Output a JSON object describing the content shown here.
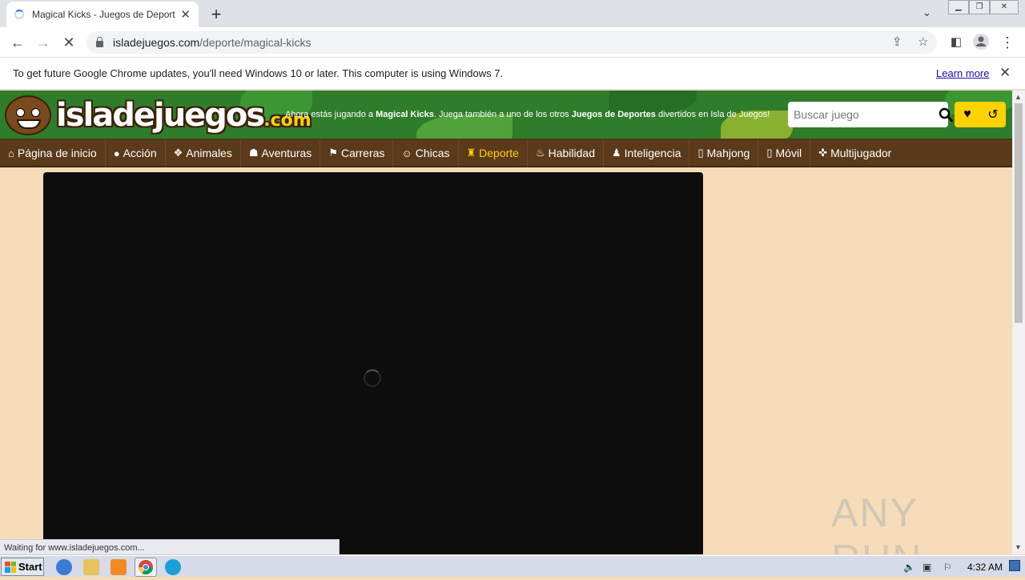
{
  "browser": {
    "tab_title": "Magical Kicks - Juegos de Deportes",
    "url_domain": "isladejuegos.com",
    "url_path": "/deporte/magical-kicks",
    "info_text": "To get future Google Chrome updates, you'll need Windows 10 or later. This computer is using Windows 7.",
    "info_link": "Learn more",
    "status_text": "Waiting for www.isladejuegos.com..."
  },
  "site": {
    "logo_main": "isladejuegos",
    "logo_suffix": ".com",
    "tagline_pre": "Ahora estás jugando a ",
    "tagline_game": "Magical Kicks",
    "tagline_mid": ". Juega también a uno de los otros ",
    "tagline_category": "Juegos de Deportes",
    "tagline_post": " divertidos en Isla de Juegos!",
    "search_placeholder": "Buscar juego"
  },
  "nav": {
    "items": [
      {
        "label": "Página de inicio",
        "icon": "home-icon",
        "glyph": "⌂"
      },
      {
        "label": "Acción",
        "icon": "bomb-icon",
        "glyph": "●"
      },
      {
        "label": "Animales",
        "icon": "paw-icon",
        "glyph": "❖"
      },
      {
        "label": "Aventuras",
        "icon": "hat-icon",
        "glyph": "☗"
      },
      {
        "label": "Carreras",
        "icon": "flag-icon",
        "glyph": "⚑"
      },
      {
        "label": "Chicas",
        "icon": "girl-icon",
        "glyph": "☺"
      },
      {
        "label": "Deporte",
        "icon": "shirt-icon",
        "glyph": "♜",
        "active": true
      },
      {
        "label": "Habilidad",
        "icon": "skill-icon",
        "glyph": "♨"
      },
      {
        "label": "Inteligencia",
        "icon": "chess-icon",
        "glyph": "♟"
      },
      {
        "label": "Mahjong",
        "icon": "tile-icon",
        "glyph": "▯"
      },
      {
        "label": "Móvil",
        "icon": "mobile-icon",
        "glyph": "▯"
      },
      {
        "label": "Multijugador",
        "icon": "gamepad-icon",
        "glyph": "✜"
      }
    ]
  },
  "watermark": "ANY RUN",
  "taskbar": {
    "start_label": "Start",
    "clock": "4:32 AM"
  },
  "colors": {
    "header_green": "#2f7d2a",
    "nav_brown": "#5a3a1a",
    "active_yellow": "#ffd200",
    "page_bg": "#f6dcb9"
  }
}
